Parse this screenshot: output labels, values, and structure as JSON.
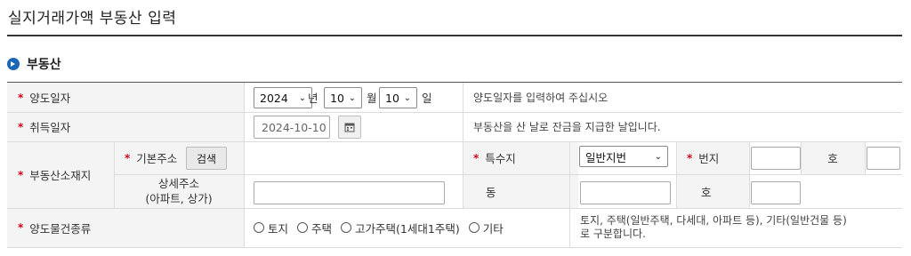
{
  "page": {
    "title": "실지거래가액 부동산 입력"
  },
  "section": {
    "title": "부동산"
  },
  "rows": {
    "transfer_date": {
      "label": "양도일자",
      "year": "2024",
      "year_unit": "년",
      "month": "10",
      "month_unit": "월",
      "day": "10",
      "day_unit": "일",
      "note": "양도일자를 입력하여 주십시오"
    },
    "acquire_date": {
      "label": "취득일자",
      "value": "2024-10-10",
      "note": "부동산을 산 날로 잔금을 지급한 날입니다."
    },
    "location": {
      "label": "부동산소재지",
      "basic_address_label": "기본주소",
      "search_button": "검색",
      "special_label": "특수지",
      "special_value": "일반지번",
      "bunji_label": "번지",
      "ho_label": "호",
      "detail_address_label": "상세주소",
      "detail_address_sub": "(아파트, 상가)",
      "dong_label": "동",
      "ho2_label": "호"
    },
    "property_type": {
      "label": "양도물건종류",
      "options": [
        "토지",
        "주택",
        "고가주택(1세대1주택)",
        "기타"
      ],
      "note_line1": "토지, 주택(일반주택, 다세대, 아파트 등), 기타(일반건물 등)",
      "note_line2": "로 구분합니다."
    }
  },
  "colors": {
    "accent": "#1b66b8",
    "required": "#d0021b",
    "header_bg": "#f4f4f4"
  }
}
